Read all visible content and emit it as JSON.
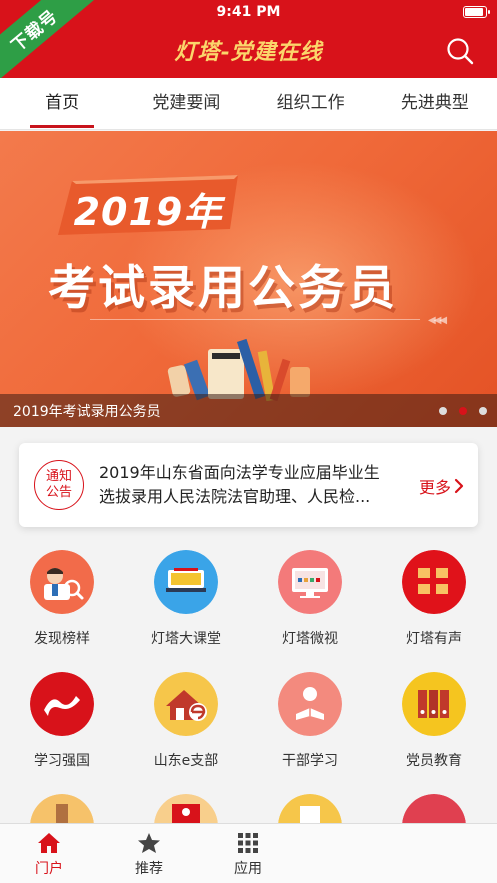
{
  "status_bar": {
    "time": "9:41 PM"
  },
  "ribbon": {
    "label": "下载号"
  },
  "header": {
    "title": "灯塔-党建在线"
  },
  "tabs": [
    {
      "label": "首页",
      "active": true
    },
    {
      "label": "党建要闻",
      "active": false
    },
    {
      "label": "组织工作",
      "active": false
    },
    {
      "label": "先进典型",
      "active": false
    }
  ],
  "banner": {
    "year": "2019年",
    "title": "考试录用公务员",
    "caption": "2019年考试录用公务员",
    "dots_count": 3,
    "active_dot": 1
  },
  "notice": {
    "badge_line1": "通知",
    "badge_line2": "公告",
    "line1": "2019年山东省面向法学专业应届毕业生",
    "line2": "选拔录用人民法院法官助理、人民检...",
    "more": "更多"
  },
  "apps": [
    {
      "label": "发现榜样",
      "icon": "person-search-icon",
      "color": "#f26b4a"
    },
    {
      "label": "灯塔大课堂",
      "icon": "classroom-icon",
      "color": "#3aa4e8"
    },
    {
      "label": "灯塔微视",
      "icon": "tv-icon",
      "color": "#f37a7a"
    },
    {
      "label": "灯塔有声",
      "icon": "audio-text-icon",
      "color": "#e0121a"
    },
    {
      "label": "学习强国",
      "icon": "xuexi-icon",
      "color": "#d8121a"
    },
    {
      "label": "山东e支部",
      "icon": "home-e-icon",
      "color": "#f6c64a"
    },
    {
      "label": "干部学习",
      "icon": "reader-icon",
      "color": "#f38a7e"
    },
    {
      "label": "党员教育",
      "icon": "binders-icon",
      "color": "#f5c51f"
    }
  ],
  "tabbar": [
    {
      "label": "门户",
      "icon": "home-icon",
      "active": true
    },
    {
      "label": "推荐",
      "icon": "star-icon",
      "active": false
    },
    {
      "label": "应用",
      "icon": "grid-icon",
      "active": false
    }
  ],
  "colors": {
    "brand_red": "#d8121a",
    "title_gold": "#fbd66b"
  }
}
